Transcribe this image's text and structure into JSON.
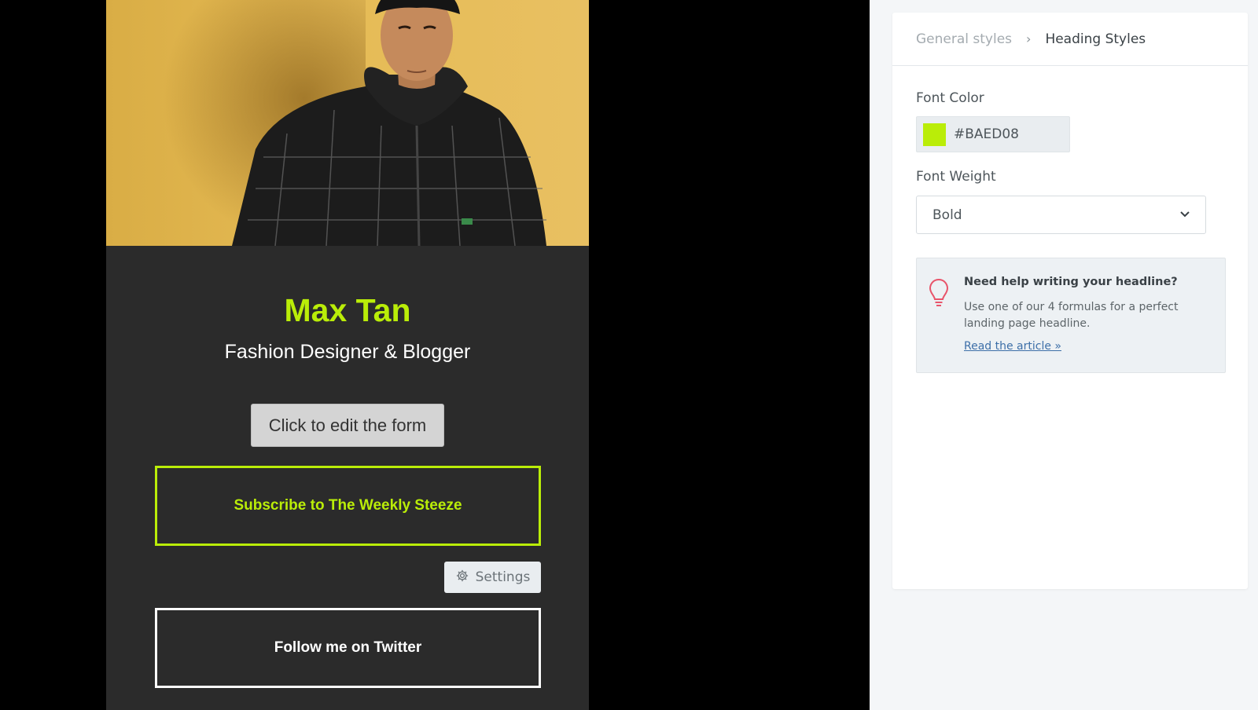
{
  "preview": {
    "hero": {
      "name": "Max Tan",
      "subtitle": "Fashion Designer & Blogger",
      "accent_color": "#BAED08"
    },
    "buttons": {
      "edit_form": "Click to edit the form",
      "subscribe": "Subscribe to The Weekly Steeze",
      "settings": "Settings",
      "twitter": "Follow me on Twitter"
    },
    "icons": {
      "settings": "gear-icon"
    }
  },
  "panel": {
    "breadcrumb": {
      "parent": "General styles",
      "separator": "›",
      "current": "Heading Styles"
    },
    "font_color": {
      "label": "Font Color",
      "value": "#BAED08"
    },
    "font_weight": {
      "label": "Font Weight",
      "value": "Bold",
      "icon": "chevron-down-icon"
    },
    "help": {
      "icon": "lightbulb-icon",
      "title": "Need help writing your headline?",
      "text": "Use one of our 4 formulas for a perfect landing page headline.",
      "link": "Read the article »"
    }
  }
}
